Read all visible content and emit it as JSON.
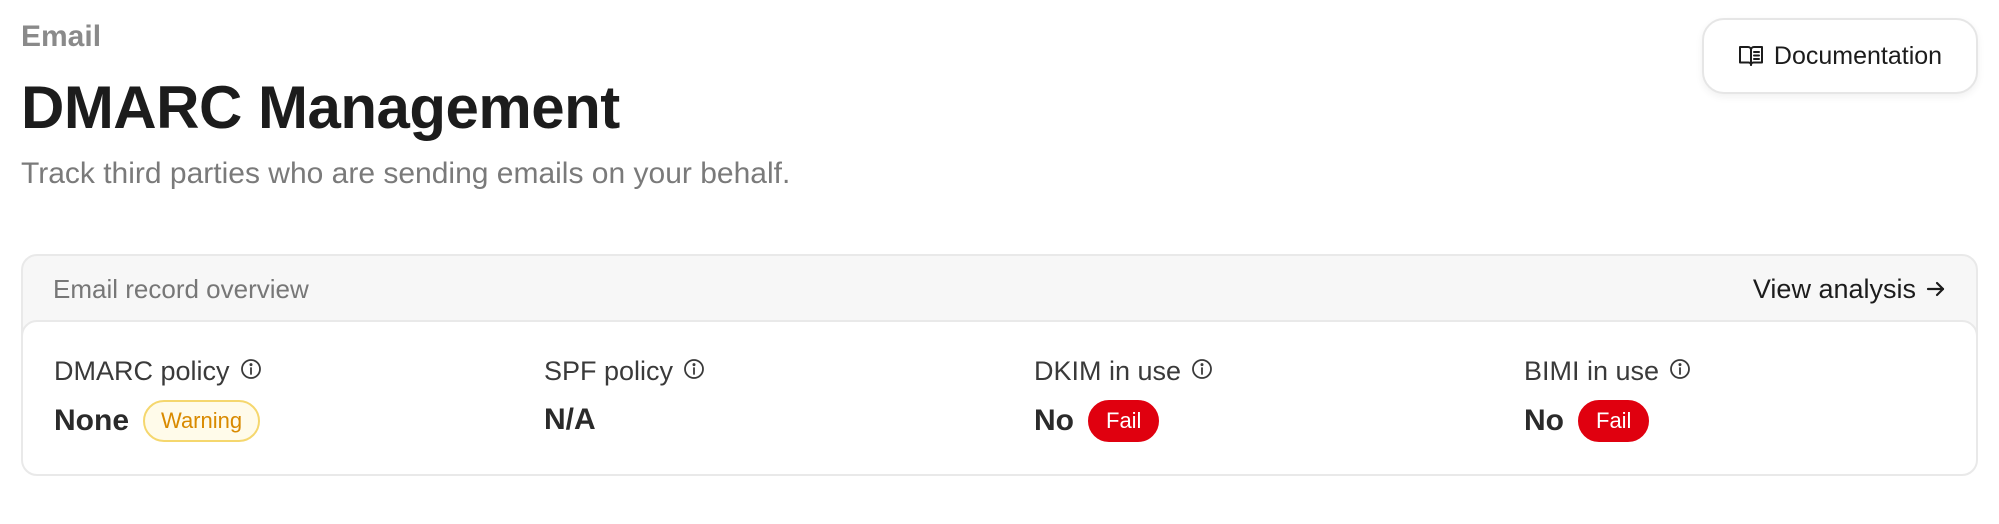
{
  "header": {
    "breadcrumb": "Email",
    "title": "DMARC Management",
    "subtitle": "Track third parties who are sending emails on your behalf.",
    "documentation_label": "Documentation",
    "documentation_icon": "book-icon"
  },
  "overview": {
    "title": "Email record overview",
    "view_analysis_label": "View analysis",
    "view_analysis_icon": "arrow-right-icon",
    "metrics": [
      {
        "label": "DMARC policy",
        "value": "None",
        "badge": "Warning",
        "badge_type": "warning"
      },
      {
        "label": "SPF policy",
        "value": "N/A",
        "badge": "",
        "badge_type": ""
      },
      {
        "label": "DKIM in use",
        "value": "No",
        "badge": "Fail",
        "badge_type": "fail"
      },
      {
        "label": "BIMI in use",
        "value": "No",
        "badge": "Fail",
        "badge_type": "fail"
      }
    ]
  },
  "colors": {
    "fail": "#e0000f",
    "warning_text": "#d98a00",
    "warning_border": "#f5d76e",
    "warning_bg": "#fffbea"
  }
}
